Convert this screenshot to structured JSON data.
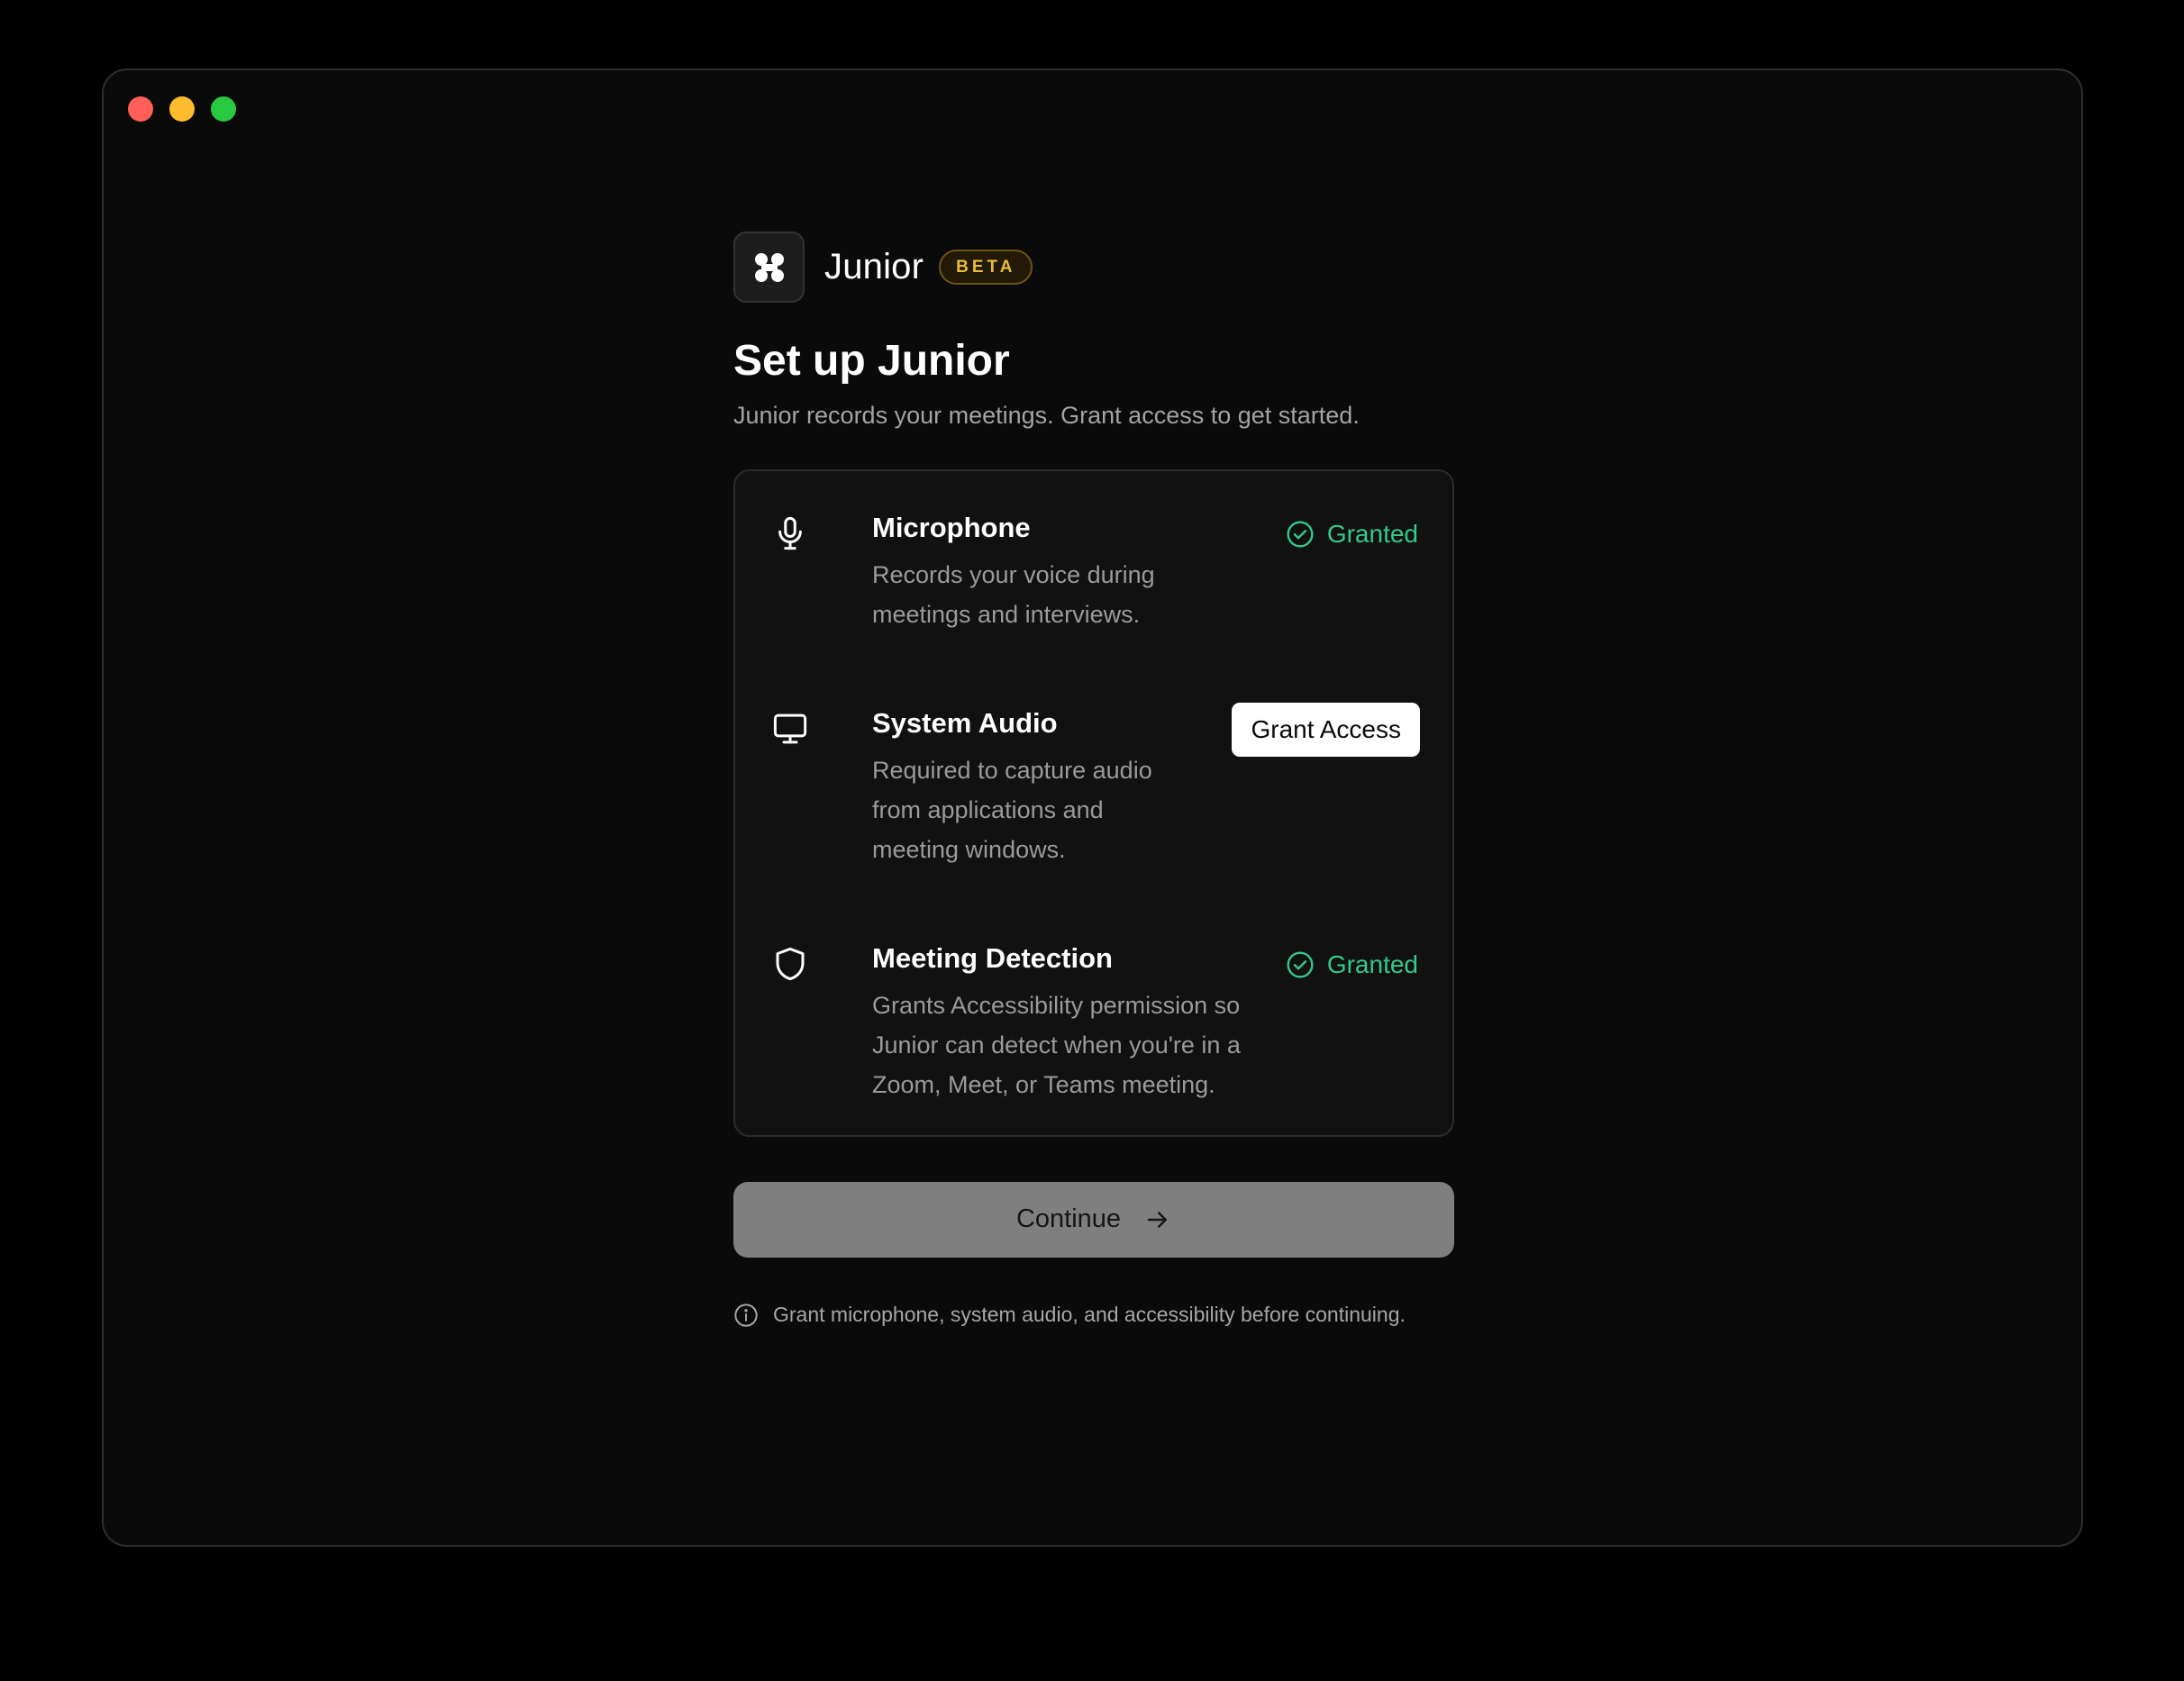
{
  "window": {
    "controls": [
      "close",
      "minimize",
      "zoom"
    ],
    "colors": {
      "close": "#ff5f57",
      "minimize": "#febc2e",
      "zoom": "#28c840"
    }
  },
  "brand": {
    "name": "Junior",
    "badge": "BETA",
    "logo_icon": "four-dots-icon"
  },
  "header": {
    "title": "Set up Junior",
    "subtitle": "Junior records your meetings. Grant access to get started."
  },
  "permissions": [
    {
      "icon": "microphone-icon",
      "title": "Microphone",
      "description": "Records your voice during meetings and interviews.",
      "status": "Granted"
    },
    {
      "icon": "monitor-icon",
      "title": "System Audio",
      "description": "Required to capture audio from applications and meeting windows.",
      "action": "Grant Access"
    },
    {
      "icon": "shield-icon",
      "title": "Meeting Detection",
      "description": "Grants Accessibility permission so Junior can detect when you're in a Zoom, Meet, or Teams meeting.",
      "status": "Granted"
    }
  ],
  "continue_button": {
    "label": "Continue",
    "icon": "arrow-right-icon",
    "enabled": false
  },
  "hint": {
    "icon": "info-icon",
    "text": "Grant microphone, system audio, and accessibility before continuing."
  },
  "colors": {
    "granted": "#34c88a",
    "beta": "#e8bd3a",
    "background": "#0a0a0a"
  }
}
